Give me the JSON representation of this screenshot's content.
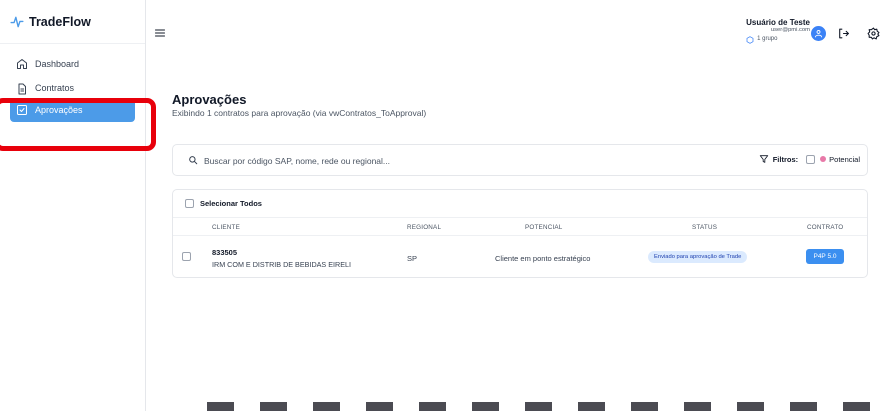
{
  "brand": {
    "name": "TradeFlow",
    "accent": "#4c9be8",
    "highlight_color": "#e8000b"
  },
  "sidebar": {
    "items": [
      {
        "label": "Dashboard",
        "icon": "home-icon",
        "active": false
      },
      {
        "label": "Contratos",
        "icon": "document-icon",
        "active": false
      },
      {
        "label": "Aprovações",
        "icon": "check-square-icon",
        "active": true
      }
    ]
  },
  "header": {
    "user_name": "Usuário de Teste",
    "user_email": "user@pmi.com",
    "group": "1 grupo",
    "icons": [
      "menu-icon",
      "user-icon",
      "logout-icon",
      "gear-icon"
    ]
  },
  "main": {
    "title": "Aprovações",
    "subtitle": "Exibindo 1 contratos para aprovação (via vwContratos_ToApproval)"
  },
  "search": {
    "placeholder": "Buscar por código SAP, nome, rede ou regional...",
    "value": ""
  },
  "filters": {
    "label": "Filtros:",
    "option": "Potencial",
    "option_color": "#e879a8"
  },
  "table": {
    "select_all": "Selecionar Todos",
    "columns": [
      "CLIENTE",
      "REGIONAL",
      "POTENCIAL",
      "STATUS",
      "CONTRATO"
    ],
    "rows": [
      {
        "code": "833505",
        "name": "IRM COM E DISTRIB DE BEBIDAS EIRELI",
        "regional": "SP",
        "potential": "Cliente em ponto estratégico",
        "status": "Enviado para aprovação de Trade",
        "contract": "P4P 5.0"
      }
    ]
  }
}
